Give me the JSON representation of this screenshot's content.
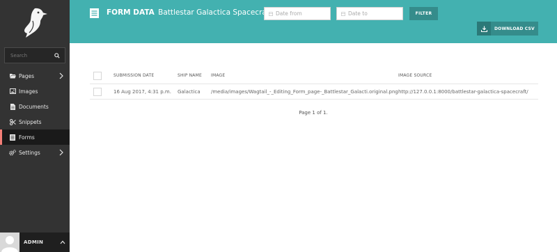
{
  "sidebar": {
    "search": {
      "placeholder": "Search"
    },
    "items": [
      {
        "label": "Pages",
        "icon": "folder-open-icon",
        "has_submenu": true,
        "active": false
      },
      {
        "label": "Images",
        "icon": "image-icon",
        "has_submenu": false,
        "active": false
      },
      {
        "label": "Documents",
        "icon": "document-icon",
        "has_submenu": false,
        "active": false
      },
      {
        "label": "Snippets",
        "icon": "snippet-icon",
        "has_submenu": false,
        "active": false
      },
      {
        "label": "Forms",
        "icon": "form-icon",
        "has_submenu": false,
        "active": true
      },
      {
        "label": "Settings",
        "icon": "cogs-icon",
        "has_submenu": true,
        "active": false
      }
    ],
    "user": {
      "name": "ADMIN"
    }
  },
  "header": {
    "title": "FORM DATA",
    "subtitle": "Battlestar Galactica Spacecraft",
    "date_from": {
      "placeholder": "Date from",
      "value": ""
    },
    "date_to": {
      "placeholder": "Date to",
      "value": ""
    },
    "filter_label": "FILTER",
    "download_label": "DOWNLOAD CSV"
  },
  "table": {
    "columns": [
      "SUBMISSION DATE",
      "SHIP NAME",
      "IMAGE",
      "IMAGE SOURCE"
    ],
    "rows": [
      {
        "submission_date": "16 Aug 2017, 4:31 p.m.",
        "ship_name": "Galactica",
        "image": "/media/images/Wagtail_-_Editing_Form_page-_Battlestar_Galacti.original.png",
        "image_source": "http://127.0.0.1:8000/battlestar-galactica-spacecraft/"
      }
    ]
  },
  "pagination": {
    "text": "Page 1 of 1."
  },
  "colors": {
    "header": "#43b1b0",
    "button": "#358c8b",
    "sidebar": "#333333",
    "active_indicator": "#f37e77"
  }
}
